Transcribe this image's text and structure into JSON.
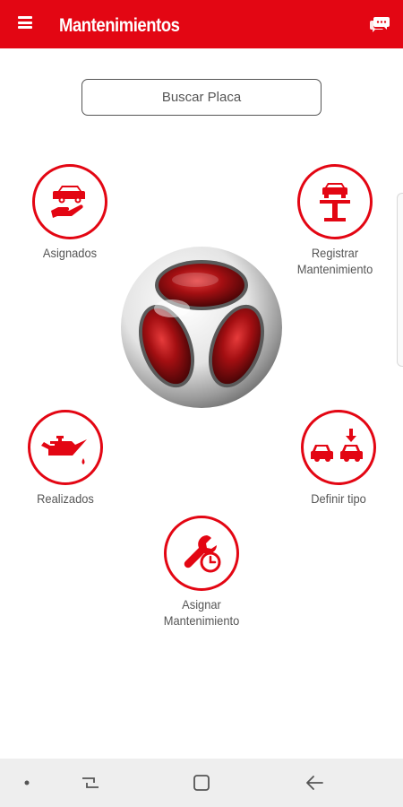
{
  "header": {
    "title": "Mantenimientos",
    "menu_icon": "hamburger-menu-icon",
    "chat_icon": "chat-bubbles-icon"
  },
  "search": {
    "placeholder": "Buscar Placa"
  },
  "actions": [
    {
      "label": "Asignados",
      "icon": "car-in-hand-icon"
    },
    {
      "label": "Registrar\nMantenimiento",
      "icon": "car-lift-icon"
    },
    {
      "label": "Realizados",
      "icon": "oil-can-icon"
    },
    {
      "label": "Definir tipo",
      "icon": "two-cars-arrow-icon"
    },
    {
      "label": "Asignar\nMantenimiento",
      "icon": "wrench-clock-icon"
    }
  ],
  "logo": {
    "icon": "red-sphere-logo-icon"
  },
  "navbar": {
    "buttons": [
      "dot-icon",
      "recent-apps-icon",
      "home-square-icon",
      "back-arrow-icon"
    ]
  },
  "colors": {
    "accent": "#e30613",
    "text": "#555555",
    "navbar": "#eeeeee"
  }
}
